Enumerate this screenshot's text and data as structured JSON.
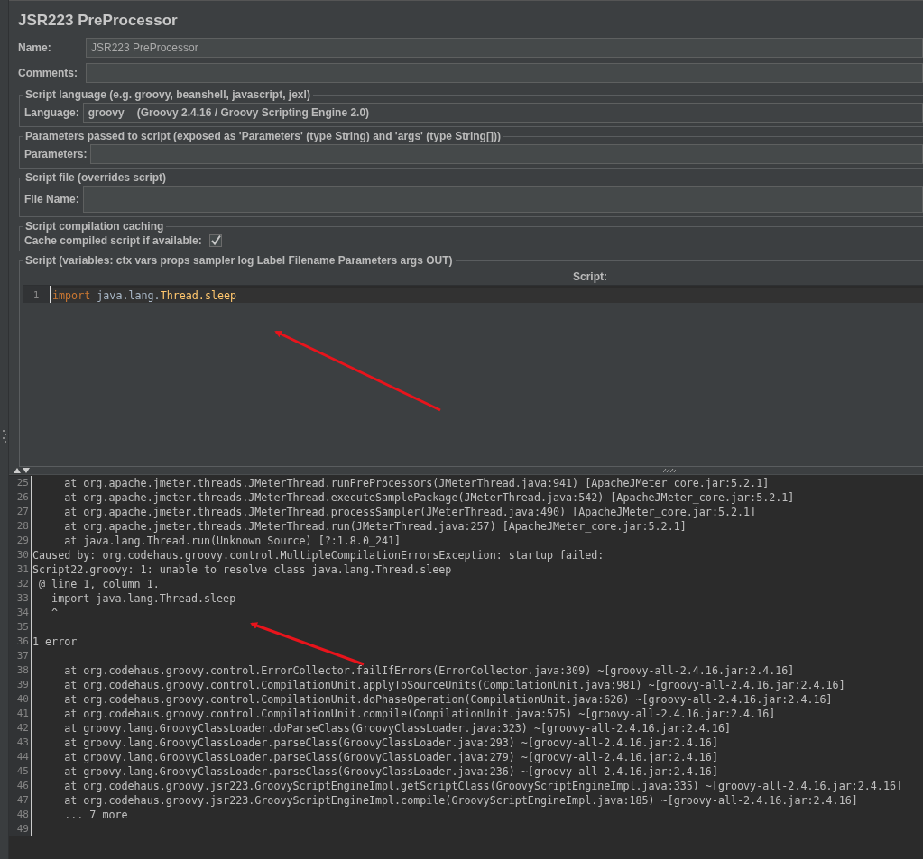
{
  "title": "JSR223 PreProcessor",
  "name_field": {
    "label": "Name:",
    "value": "JSR223 PreProcessor"
  },
  "comments_field": {
    "label": "Comments:"
  },
  "language_group": {
    "legend": "Script language (e.g. groovy, beanshell, javascript, jexl)",
    "label": "Language:",
    "value": "groovy",
    "detail": "(Groovy 2.4.16 / Groovy Scripting Engine 2.0)"
  },
  "parameters_group": {
    "legend": "Parameters passed to script (exposed as 'Parameters' (type String) and 'args' (type String[]))",
    "label": "Parameters:"
  },
  "file_group": {
    "legend": "Script file (overrides script)",
    "label": "File Name:"
  },
  "caching_group": {
    "legend": "Script compilation caching",
    "label": "Cache compiled script if available:",
    "checked": true
  },
  "script_group": {
    "legend": "Script (variables: ctx vars props sampler log Label Filename Parameters args OUT)",
    "header": "Script:",
    "lines": [
      {
        "number": "1",
        "tokens": [
          {
            "kind": "keyword",
            "text": "import"
          },
          {
            "kind": "plain",
            "text": " java.lang."
          },
          {
            "kind": "type",
            "text": "Thread.sleep"
          }
        ]
      }
    ]
  },
  "log": {
    "lines": [
      {
        "number": "25",
        "text": "     at org.apache.jmeter.threads.JMeterThread.runPreProcessors(JMeterThread.java:941) [ApacheJMeter_core.jar:5.2.1]"
      },
      {
        "number": "26",
        "text": "     at org.apache.jmeter.threads.JMeterThread.executeSamplePackage(JMeterThread.java:542) [ApacheJMeter_core.jar:5.2.1]"
      },
      {
        "number": "27",
        "text": "     at org.apache.jmeter.threads.JMeterThread.processSampler(JMeterThread.java:490) [ApacheJMeter_core.jar:5.2.1]"
      },
      {
        "number": "28",
        "text": "     at org.apache.jmeter.threads.JMeterThread.run(JMeterThread.java:257) [ApacheJMeter_core.jar:5.2.1]"
      },
      {
        "number": "29",
        "text": "     at java.lang.Thread.run(Unknown Source) [?:1.8.0_241]"
      },
      {
        "number": "30",
        "text": "Caused by: org.codehaus.groovy.control.MultipleCompilationErrorsException: startup failed:"
      },
      {
        "number": "31",
        "text": "Script22.groovy: 1: unable to resolve class java.lang.Thread.sleep"
      },
      {
        "number": "32",
        "text": " @ line 1, column 1."
      },
      {
        "number": "33",
        "text": "   import java.lang.Thread.sleep"
      },
      {
        "number": "34",
        "text": "   ^"
      },
      {
        "number": "35"
      },
      {
        "number": "36",
        "text": "1 error"
      },
      {
        "number": "37"
      },
      {
        "number": "38",
        "text": "     at org.codehaus.groovy.control.ErrorCollector.failIfErrors(ErrorCollector.java:309) ~[groovy-all-2.4.16.jar:2.4.16]"
      },
      {
        "number": "39",
        "text": "     at org.codehaus.groovy.control.CompilationUnit.applyToSourceUnits(CompilationUnit.java:981) ~[groovy-all-2.4.16.jar:2.4.16]"
      },
      {
        "number": "40",
        "text": "     at org.codehaus.groovy.control.CompilationUnit.doPhaseOperation(CompilationUnit.java:626) ~[groovy-all-2.4.16.jar:2.4.16]"
      },
      {
        "number": "41",
        "text": "     at org.codehaus.groovy.control.CompilationUnit.compile(CompilationUnit.java:575) ~[groovy-all-2.4.16.jar:2.4.16]"
      },
      {
        "number": "42",
        "text": "     at groovy.lang.GroovyClassLoader.doParseClass(GroovyClassLoader.java:323) ~[groovy-all-2.4.16.jar:2.4.16]"
      },
      {
        "number": "43",
        "text": "     at groovy.lang.GroovyClassLoader.parseClass(GroovyClassLoader.java:293) ~[groovy-all-2.4.16.jar:2.4.16]"
      },
      {
        "number": "44",
        "text": "     at groovy.lang.GroovyClassLoader.parseClass(GroovyClassLoader.java:279) ~[groovy-all-2.4.16.jar:2.4.16]"
      },
      {
        "number": "45",
        "text": "     at groovy.lang.GroovyClassLoader.parseClass(GroovyClassLoader.java:236) ~[groovy-all-2.4.16.jar:2.4.16]"
      },
      {
        "number": "46",
        "text": "     at org.codehaus.groovy.jsr223.GroovyScriptEngineImpl.getScriptClass(GroovyScriptEngineImpl.java:335) ~[groovy-all-2.4.16.jar:2.4.16]"
      },
      {
        "number": "47",
        "text": "     at org.codehaus.groovy.jsr223.GroovyScriptEngineImpl.compile(GroovyScriptEngineImpl.java:185) ~[groovy-all-2.4.16.jar:2.4.16]"
      },
      {
        "number": "48",
        "text": "     ... 7 more"
      },
      {
        "number": "49"
      }
    ]
  }
}
